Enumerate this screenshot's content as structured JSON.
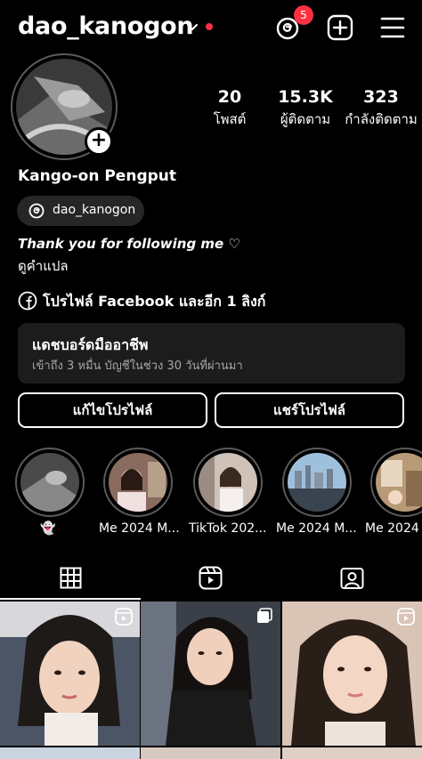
{
  "header": {
    "username": "dao_kanogon",
    "threads_badge_count": "5",
    "icons": [
      "chevron-down-icon",
      "threads-icon",
      "new-post-icon",
      "menu-icon"
    ]
  },
  "profile": {
    "stats": [
      {
        "value": "20",
        "label": "โพสต์"
      },
      {
        "value": "15.3K",
        "label": "ผู้ติดตาม"
      },
      {
        "value": "323",
        "label": "กำลังติดตาม"
      }
    ],
    "full_name": "Kango-on Pengput",
    "threads_handle": "dao_kanogon",
    "bio_line1": "Thank you for following me ♡",
    "bio_line2": "ดูคำแปล",
    "link_text": "โปรไฟล์ Facebook และอีก 1 ลิงก์"
  },
  "dashboard": {
    "title": "แดชบอร์ดมืออาชีพ",
    "subtitle": "เข้าถึง 3 หมื่น บัญชีในช่วง 30 วันที่ผ่านมา"
  },
  "actions": {
    "edit_profile": "แก้ไขโปรไฟล์",
    "share_profile": "แชร์โปรไฟล์"
  },
  "highlights": [
    {
      "label": "👻"
    },
    {
      "label": "Me 2024 M..."
    },
    {
      "label": "TikTok 202..."
    },
    {
      "label": "Me 2024 M..."
    },
    {
      "label": "Me 2024"
    }
  ],
  "tabs": [
    "grid-icon",
    "reels-icon",
    "tagged-icon"
  ],
  "colors": {
    "accent_red": "#ff3040",
    "pill_bg": "#262626",
    "card_bg": "#1c1c1c"
  }
}
